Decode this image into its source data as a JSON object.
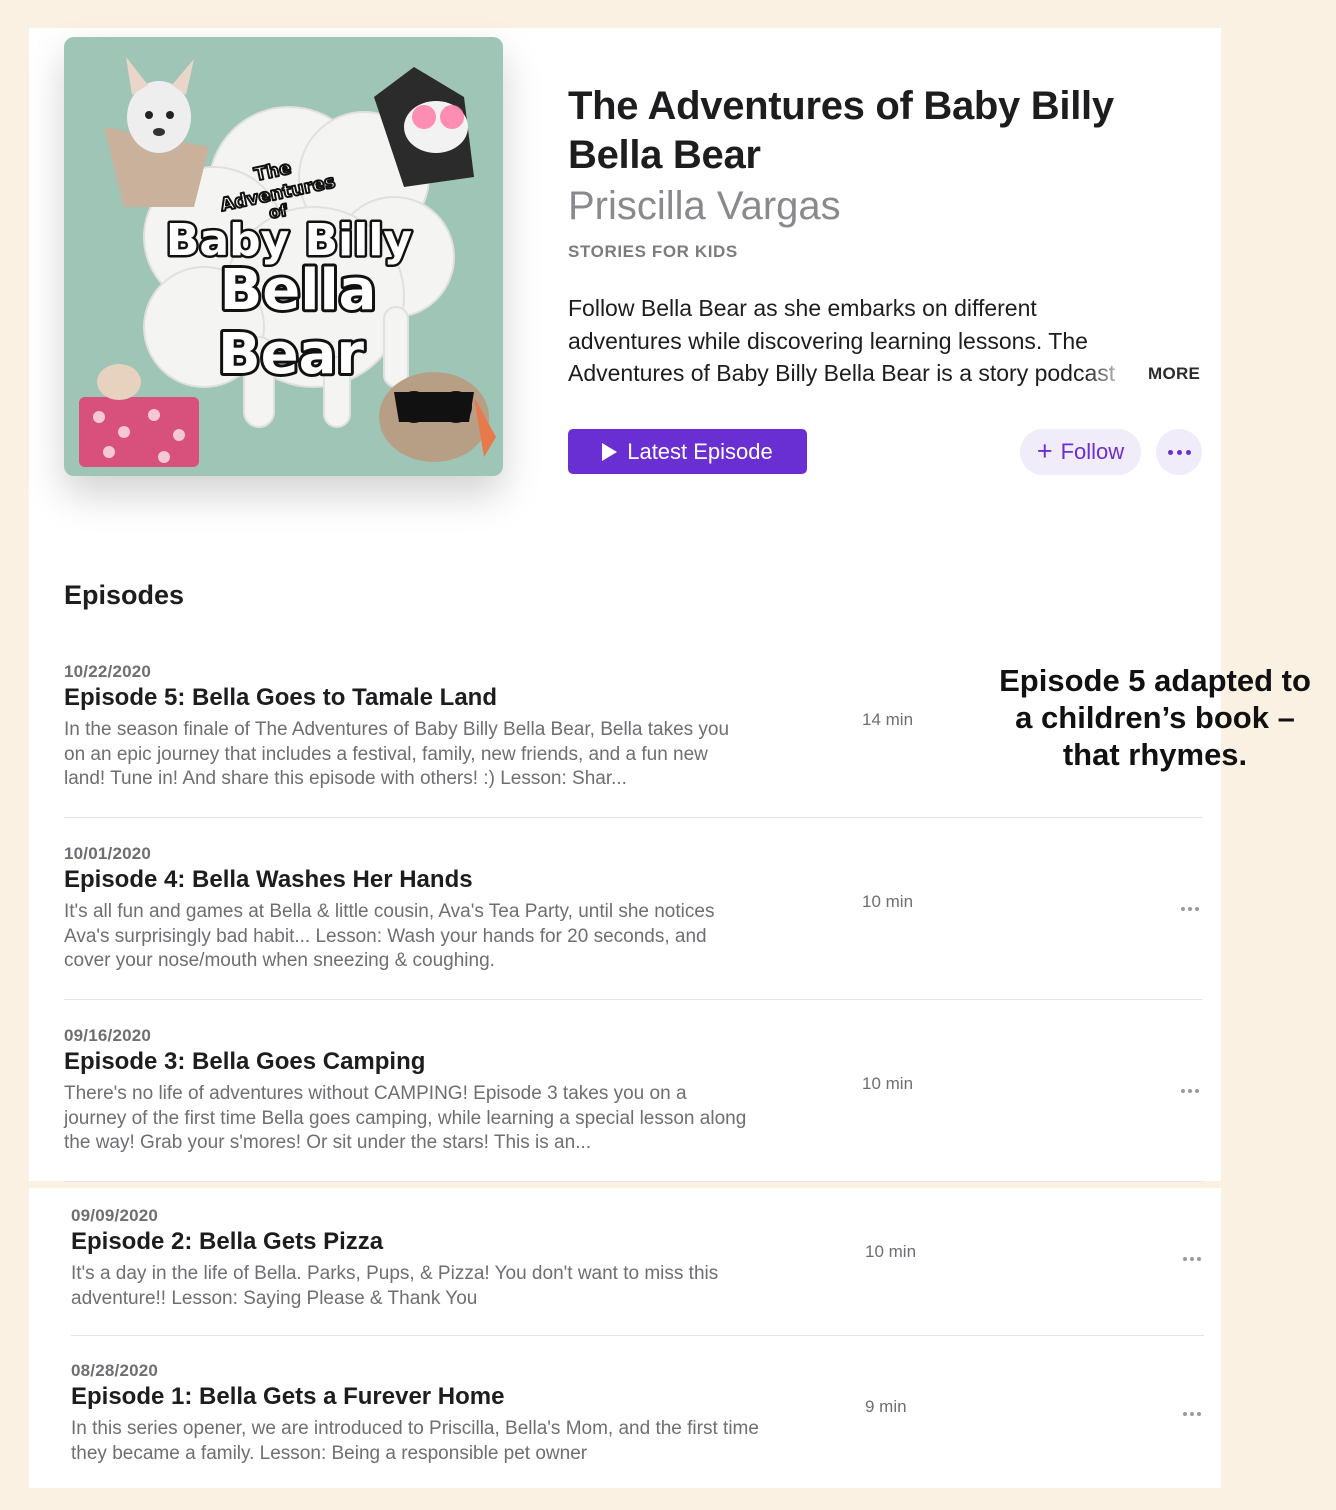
{
  "podcast": {
    "artwork_text": {
      "line1": "The",
      "line2": "Adventures",
      "line3": "of",
      "line4": "Baby Billy",
      "line5": "Bella",
      "line6": "Bear"
    },
    "title": "The Adventures of Baby Billy Bella Bear",
    "author": "Priscilla Vargas",
    "category": "STORIES FOR KIDS",
    "description": "Follow Bella Bear as she embarks on different adventures while discovering learning lessons. The Adventures of Baby Billy Bella Bear is a story podcast",
    "more_label": "MORE",
    "latest_episode_label": "Latest Episode",
    "follow_label": "Follow"
  },
  "episodes_heading": "Episodes",
  "episodes": [
    {
      "date": "10/22/2020",
      "title": "Episode 5: Bella Goes to Tamale Land",
      "description": "In the season finale of The Adventures of Baby Billy Bella Bear, Bella takes you on an epic journey that includes a festival, family, new friends, and a fun new land!  Tune in! And share this episode with others! :)  Lesson: Shar...",
      "duration": "14 min"
    },
    {
      "date": "10/01/2020",
      "title": "Episode 4: Bella Washes Her Hands",
      "description": "It's all fun and games at Bella & little cousin, Ava's Tea Party, until she notices Ava's surprisingly bad habit... Lesson: Wash your hands for 20 seconds, and cover your nose/mouth when sneezing & coughing.",
      "duration": "10 min"
    },
    {
      "date": "09/16/2020",
      "title": "Episode 3: Bella Goes Camping",
      "description": "There's no life of adventures without CAMPING! Episode 3 takes you on a journey of the first time Bella goes camping, while learning a special lesson along the way!  Grab your s'mores! Or sit under the stars! This is an...",
      "duration": "10 min"
    },
    {
      "date": "09/09/2020",
      "title": "Episode 2: Bella Gets Pizza",
      "description": "It's a day in the life of Bella. Parks, Pups, & Pizza! You don't want to miss this adventure!! Lesson: Saying Please & Thank You",
      "duration": "10 min"
    },
    {
      "date": "08/28/2020",
      "title": "Episode 1: Bella Gets a Furever Home",
      "description": "In this series opener, we are introduced to Priscilla, Bella's Mom, and the first time they became a family.  Lesson: Being a responsible pet owner",
      "duration": "9 min"
    }
  ],
  "annotation": "Episode 5 adapted to a children’s book – that rhymes.",
  "colors": {
    "accent": "#6a2fd2",
    "accent_soft": "#f1ecfa",
    "background": "#fbf1e3",
    "artwork_bg": "#9ec5b6"
  },
  "icons": [
    "play-icon",
    "plus-icon",
    "more-icon",
    "ellipsis-icon"
  ]
}
